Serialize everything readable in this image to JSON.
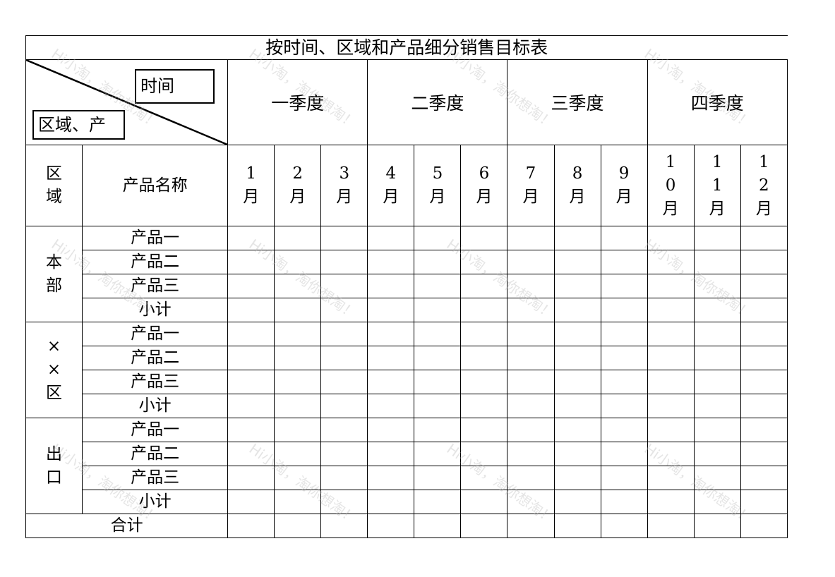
{
  "title": "按时间、区域和产品细分销售目标表",
  "corner": {
    "time_label": "时间",
    "region_label": "区域、产"
  },
  "quarters": [
    "一季度",
    "二季度",
    "三季度",
    "四季度"
  ],
  "header": {
    "region_col": "区域",
    "product_col": "产品名称",
    "months": [
      "1月",
      "2月",
      "3月",
      "4月",
      "5月",
      "6月",
      "7月",
      "8月",
      "9月",
      "10月",
      "11月",
      "12月"
    ]
  },
  "groups": [
    {
      "region": "本部",
      "rows": [
        "产品一",
        "产品二",
        "产品三",
        "小计"
      ]
    },
    {
      "region": "××区",
      "rows": [
        "产品一",
        "产品二",
        "产品三",
        "小计"
      ]
    },
    {
      "region": "出口",
      "rows": [
        "产品一",
        "产品二",
        "产品三",
        "小计"
      ]
    }
  ],
  "total_label": "合计",
  "watermark": "Hi小淘，淘你想淘！"
}
